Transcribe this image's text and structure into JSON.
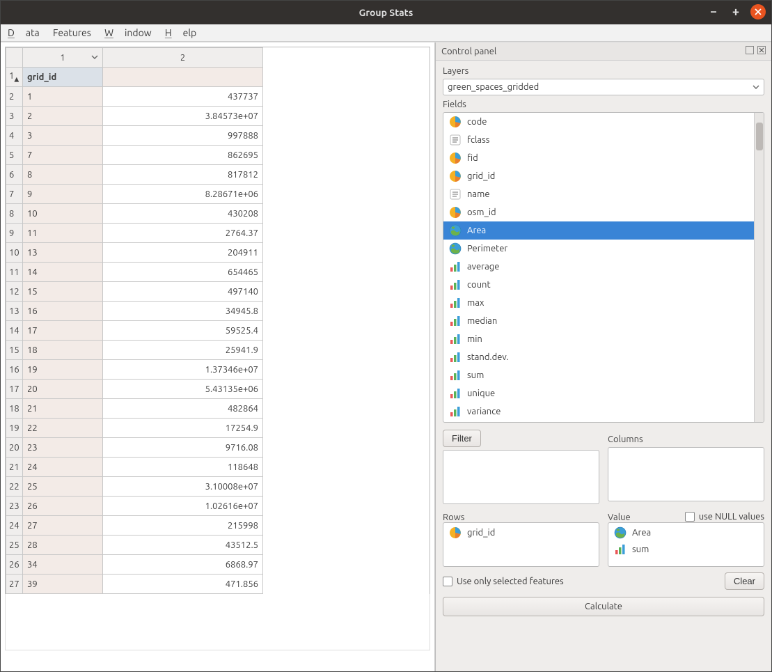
{
  "window": {
    "title": "Group Stats"
  },
  "menu": {
    "data": "Data",
    "features": "Features",
    "window": "Window",
    "help": "Help"
  },
  "table": {
    "col_headers": [
      "1",
      "2"
    ],
    "header_row_idx": "1",
    "header_cells": [
      "grid_id",
      ""
    ],
    "rows": [
      {
        "n": "2",
        "c1": "1",
        "c2": "437737"
      },
      {
        "n": "3",
        "c1": "2",
        "c2": "3.84573e+07"
      },
      {
        "n": "4",
        "c1": "3",
        "c2": "997888"
      },
      {
        "n": "5",
        "c1": "7",
        "c2": "862695"
      },
      {
        "n": "6",
        "c1": "8",
        "c2": "817812"
      },
      {
        "n": "7",
        "c1": "9",
        "c2": "8.28671e+06"
      },
      {
        "n": "8",
        "c1": "10",
        "c2": "430208"
      },
      {
        "n": "9",
        "c1": "11",
        "c2": "2764.37"
      },
      {
        "n": "10",
        "c1": "13",
        "c2": "204911"
      },
      {
        "n": "11",
        "c1": "14",
        "c2": "654465"
      },
      {
        "n": "12",
        "c1": "15",
        "c2": "497140"
      },
      {
        "n": "13",
        "c1": "16",
        "c2": "34945.8"
      },
      {
        "n": "14",
        "c1": "17",
        "c2": "59525.4"
      },
      {
        "n": "15",
        "c1": "18",
        "c2": "25941.9"
      },
      {
        "n": "16",
        "c1": "19",
        "c2": "1.37346e+07"
      },
      {
        "n": "17",
        "c1": "20",
        "c2": "5.43135e+06"
      },
      {
        "n": "18",
        "c1": "21",
        "c2": "482864"
      },
      {
        "n": "19",
        "c1": "22",
        "c2": "17254.9"
      },
      {
        "n": "20",
        "c1": "23",
        "c2": "9716.08"
      },
      {
        "n": "21",
        "c1": "24",
        "c2": "118648"
      },
      {
        "n": "22",
        "c1": "25",
        "c2": "3.10008e+07"
      },
      {
        "n": "23",
        "c1": "26",
        "c2": "1.02616e+07"
      },
      {
        "n": "24",
        "c1": "27",
        "c2": "215998"
      },
      {
        "n": "25",
        "c1": "28",
        "c2": "43512.5"
      },
      {
        "n": "26",
        "c1": "34",
        "c2": "6868.97"
      },
      {
        "n": "27",
        "c1": "39",
        "c2": "471.856"
      }
    ]
  },
  "panel": {
    "title": "Control panel",
    "layers_label": "Layers",
    "layer_selected": "green_spaces_gridded",
    "fields_label": "Fields",
    "fields": [
      {
        "name": "code",
        "icon": "pie"
      },
      {
        "name": "fclass",
        "icon": "text"
      },
      {
        "name": "fid",
        "icon": "pie"
      },
      {
        "name": "grid_id",
        "icon": "pie"
      },
      {
        "name": "name",
        "icon": "text"
      },
      {
        "name": "osm_id",
        "icon": "pie"
      },
      {
        "name": "Area",
        "icon": "globe",
        "selected": true
      },
      {
        "name": "Perimeter",
        "icon": "globe"
      },
      {
        "name": "average",
        "icon": "bar"
      },
      {
        "name": "count",
        "icon": "bar"
      },
      {
        "name": "max",
        "icon": "bar"
      },
      {
        "name": "median",
        "icon": "bar"
      },
      {
        "name": "min",
        "icon": "bar"
      },
      {
        "name": "stand.dev.",
        "icon": "bar"
      },
      {
        "name": "sum",
        "icon": "bar"
      },
      {
        "name": "unique",
        "icon": "bar"
      },
      {
        "name": "variance",
        "icon": "bar"
      }
    ],
    "filter_btn": "Filter",
    "columns_label": "Columns",
    "rows_label": "Rows",
    "value_label": "Value",
    "null_label": "use NULL values",
    "rows_items": [
      {
        "name": "grid_id",
        "icon": "pie"
      }
    ],
    "value_items": [
      {
        "name": "Area",
        "icon": "globe"
      },
      {
        "name": "sum",
        "icon": "bar"
      }
    ],
    "only_selected": "Use only selected features",
    "clear_btn": "Clear",
    "calc_btn": "Calculate"
  }
}
